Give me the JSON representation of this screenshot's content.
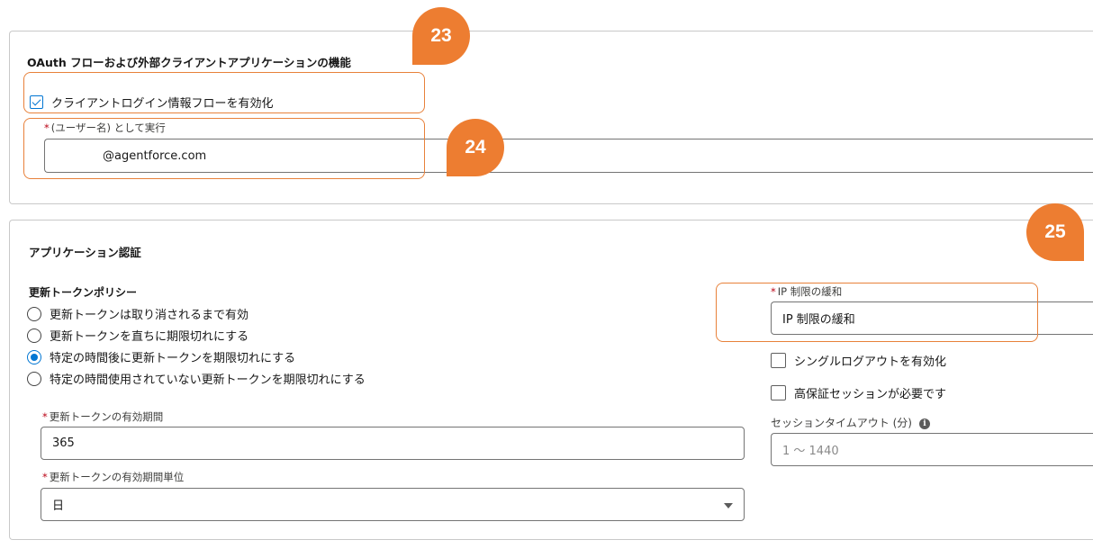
{
  "oauth_section": {
    "title": "OAuth フローおよび外部クライアントアプリケーションの機能",
    "client_credentials": {
      "label": "クライアントログイン情報フローを有効化",
      "checked": true
    },
    "run_as": {
      "required_mark": "*",
      "label": "(ユーザー名) として実行",
      "value": "@agentforce.com"
    }
  },
  "auth_section": {
    "title": "アプリケーション認証",
    "refresh_policy": {
      "label": "更新トークンポリシー",
      "options": [
        {
          "label": "更新トークンは取り消されるまで有効",
          "selected": false
        },
        {
          "label": "更新トークンを直ちに期限切れにする",
          "selected": false
        },
        {
          "label": "特定の時間後に更新トークンを期限切れにする",
          "selected": true
        },
        {
          "label": "特定の時間使用されていない更新トークンを期限切れにする",
          "selected": false
        }
      ]
    },
    "validity_period": {
      "required_mark": "*",
      "label": "更新トークンの有効期間",
      "value": "365"
    },
    "validity_unit": {
      "required_mark": "*",
      "label": "更新トークンの有効期間単位",
      "value": "日"
    },
    "ip_relaxation": {
      "required_mark": "*",
      "label": "IP 制限の緩和",
      "value": "IP 制限の緩和"
    },
    "single_logout": {
      "label": "シングルログアウトを有効化",
      "checked": false
    },
    "high_assurance": {
      "label": "高保証セッションが必要です",
      "checked": false
    },
    "session_timeout": {
      "label": "セッションタイムアウト (分)",
      "placeholder": "1 ～ 1440",
      "info_icon": "info-icon"
    }
  },
  "callouts": {
    "badge_23": "23",
    "badge_24": "24",
    "badge_25": "25"
  },
  "colors": {
    "accent": "#0176d3",
    "callout": "#ed7d31",
    "required": "#ba0517"
  }
}
